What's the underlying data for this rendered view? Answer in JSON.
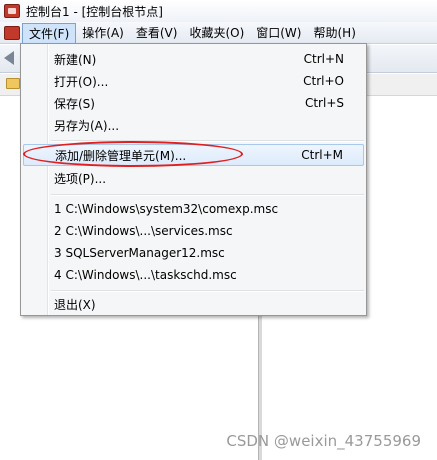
{
  "window": {
    "title": "控制台1 - [控制台根节点]"
  },
  "menubar": {
    "items": [
      "文件(F)",
      "操作(A)",
      "查看(V)",
      "收藏夹(O)",
      "窗口(W)",
      "帮助(H)"
    ]
  },
  "file_menu": {
    "new": {
      "label": "新建(N)",
      "shortcut": "Ctrl+N"
    },
    "open": {
      "label": "打开(O)...",
      "shortcut": "Ctrl+O"
    },
    "save": {
      "label": "保存(S)",
      "shortcut": "Ctrl+S"
    },
    "save_as": {
      "label": "另存为(A)..."
    },
    "add_remove_snapin": {
      "label": "添加/删除管理单元(M)...",
      "shortcut": "Ctrl+M"
    },
    "options": {
      "label": "选项(P)..."
    },
    "recent": [
      "1 C:\\Windows\\system32\\comexp.msc",
      "2 C:\\Windows\\...\\services.msc",
      "3 SQLServerManager12.msc",
      "4 C:\\Windows\\...\\taskschd.msc"
    ],
    "exit": {
      "label": "退出(X)"
    }
  },
  "watermark": "CSDN @weixin_43755969",
  "colors": {
    "highlight_border": "#a8c8ec",
    "annotation_ellipse": "#e02020"
  }
}
